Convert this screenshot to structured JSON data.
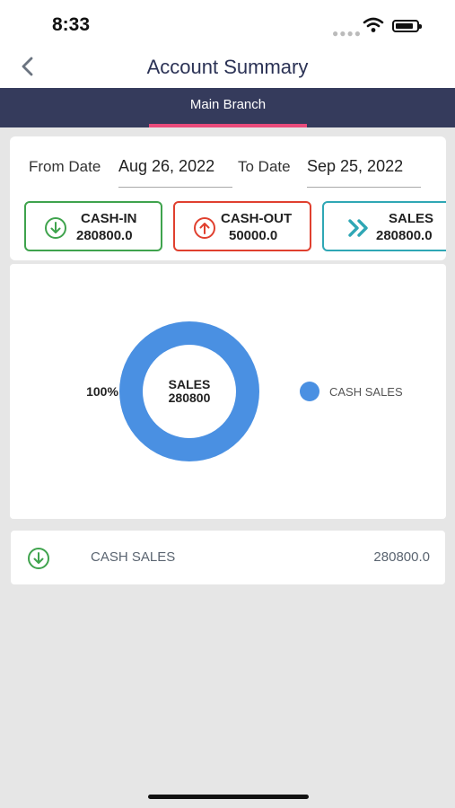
{
  "status": {
    "time": "8:33"
  },
  "header": {
    "title": "Account Summary"
  },
  "branch": {
    "tab": "Main Branch"
  },
  "filters": {
    "from_label": "From Date",
    "from_value": "Aug 26, 2022",
    "to_label": "To Date",
    "to_value": "Sep 25, 2022"
  },
  "tiles": [
    {
      "label": "CASH-IN",
      "value": "280800.0",
      "color": "#3fa34d",
      "icon": "arrow-down-circle-icon"
    },
    {
      "label": "CASH-OUT",
      "value": "50000.0",
      "color": "#e0402f",
      "icon": "arrow-up-circle-icon"
    },
    {
      "label": "SALES",
      "value": "280800.0",
      "color": "#2fa7b5",
      "icon": "double-chevron-right-icon"
    }
  ],
  "chart_data": {
    "type": "pie",
    "center_title": "SALES",
    "center_value": "280800",
    "slices": [
      {
        "label": "CASH SALES",
        "value": 280800,
        "percent_label": "100%",
        "color": "#4a90e2"
      }
    ],
    "legend": {
      "placement": "right"
    }
  },
  "list": [
    {
      "icon": "arrow-down-circle-icon",
      "label": "CASH SALES",
      "amount": "280800.0",
      "color": "#3fa34d"
    }
  ]
}
